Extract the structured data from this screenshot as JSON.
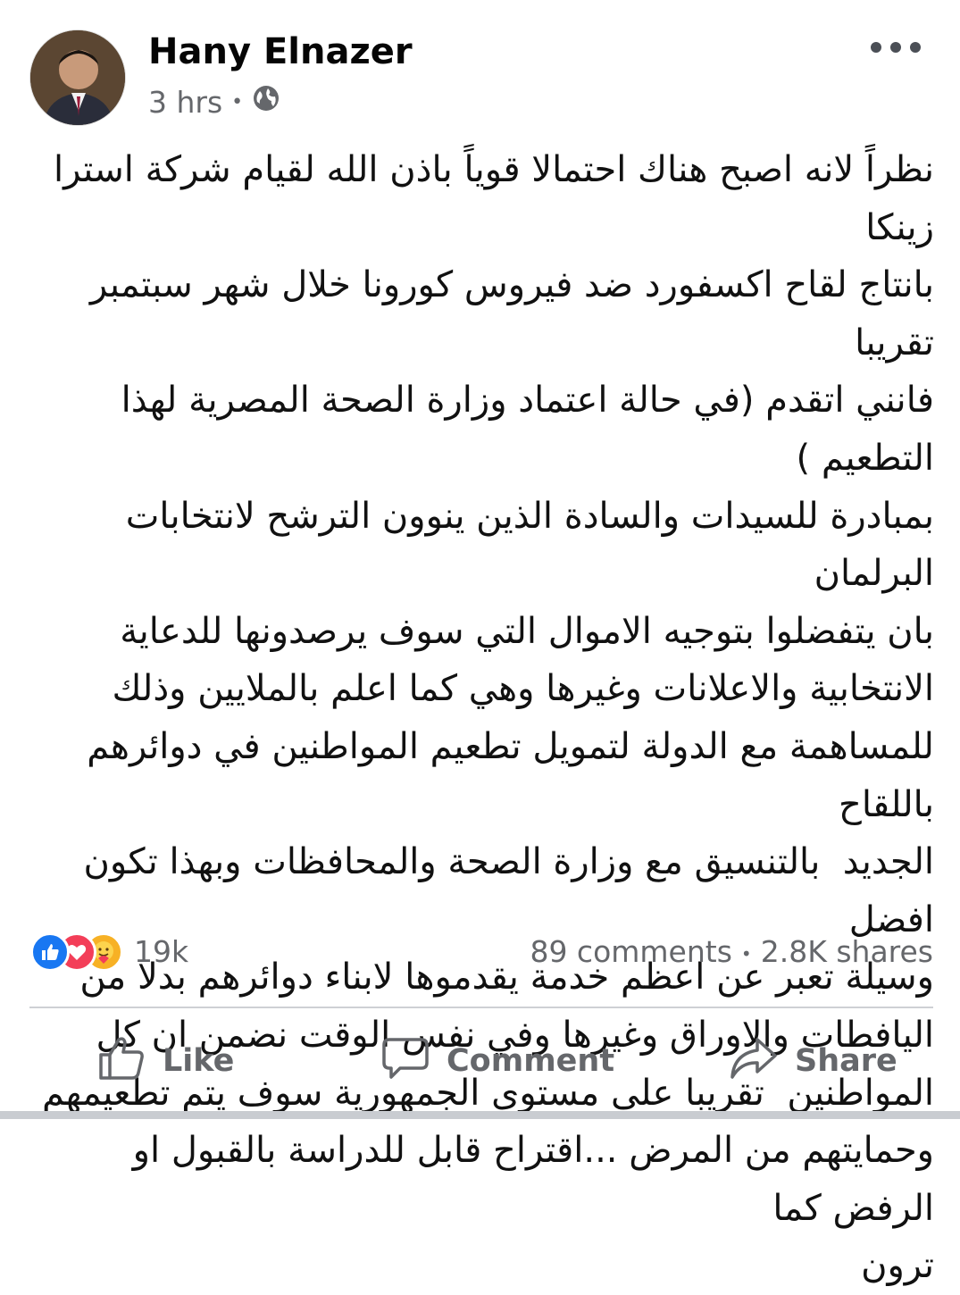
{
  "post": {
    "author": "Hany Elnazer",
    "time": "3 hrs",
    "audience_icon": "globe-icon",
    "text": "نظراً لانه اصبح هناك احتمالا قوياً باذن الله لقيام شركة استرا زينكا\nبانتاج لقاح اكسفورد ضد فيروس كورونا خلال شهر سبتمبر تقريبا\nفانني اتقدم (في حالة اعتماد وزارة الصحة المصرية لهذا التطعيم )\nبمبادرة للسيدات والسادة الذين ينوون الترشح لانتخابات البرلمان\nبان يتفضلوا بتوجيه الاموال التي سوف يرصدونها للدعاية\nالانتخابية والاعلانات وغيرها وهي كما اعلم بالملايين وذلك\nللمساهمة مع الدولة لتمويل تطعيم المواطنين في دوائرهم باللقاح\nالجديد  بالتنسيق مع وزارة الصحة والمحافظات وبهذا تكون افضل\nوسيلة تعبر عن اعظم خدمة يقدموها لابناء دوائرهم بدلا من\nاليافطات والاوراق وغيرها وفي نفس الوقت نضمن ان كل\nالمواطنين  تقريبا علي مستوي الجمهورية سوف يتم تطعيمهم\nوحمايتهم من المرض ...اقتراح قابل للدراسة بالقبول او الرفض كما\nترون"
  },
  "stats": {
    "reactions_count": "19k",
    "comments": "89 comments",
    "separator": "•",
    "shares": "2.8K shares"
  },
  "actions": {
    "like": "Like",
    "comment": "Comment",
    "share": "Share"
  },
  "colors": {
    "like_blue": "#1877f2",
    "love_red": "#f33e58",
    "care_yellow": "#f7b125",
    "secondary_text": "#65676b"
  }
}
